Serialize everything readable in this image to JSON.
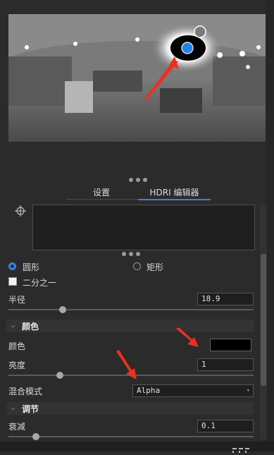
{
  "tabs": [
    {
      "label": "设置",
      "active": false
    },
    {
      "label": "HDRI 编辑器",
      "active": true
    }
  ],
  "shape": {
    "options": [
      "圆形",
      "矩形"
    ],
    "selected": "圆形"
  },
  "half_checkbox": {
    "label": "二分之一",
    "checked": false
  },
  "radius": {
    "label": "半径",
    "value": "18.9"
  },
  "color_section": {
    "title": "颜色"
  },
  "color": {
    "label": "颜色",
    "swatch": "#000000"
  },
  "brightness": {
    "label": "亮度",
    "value": "1"
  },
  "blend_mode": {
    "label": "混合模式",
    "value": "Alpha"
  },
  "adjust_section": {
    "title": "调节"
  },
  "falloff": {
    "label": "衰减",
    "value": "0.1"
  },
  "accent_color": "#3a82d8",
  "annotation_color": "#e8321e"
}
